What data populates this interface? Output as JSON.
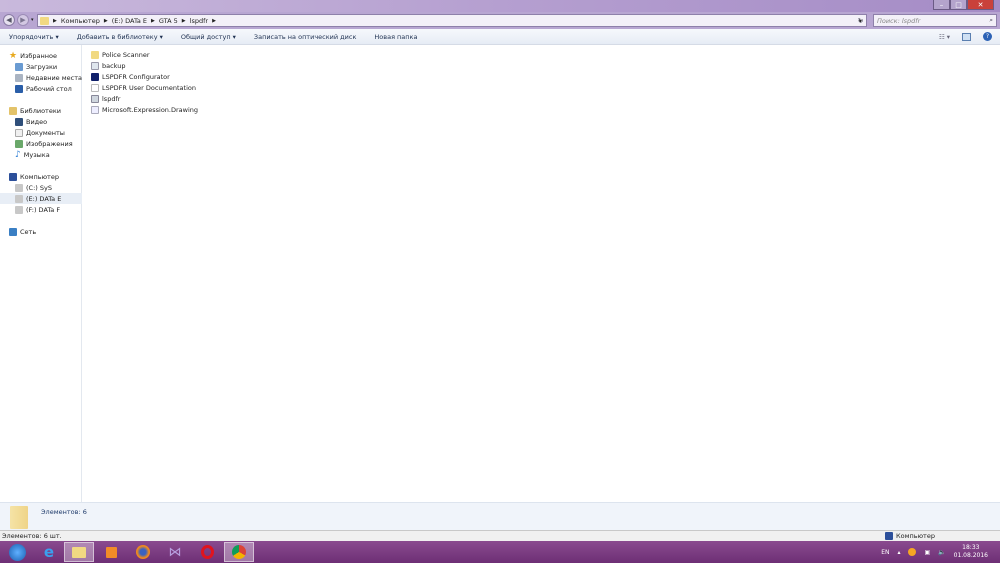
{
  "window": {
    "controls": [
      "minimize",
      "maximize",
      "close"
    ]
  },
  "address": {
    "breadcrumb": [
      "Компьютер",
      "(E:) DATa E",
      "GTA 5",
      "lspdfr"
    ],
    "search_placeholder": "Поиск: lspdfr"
  },
  "toolbar": {
    "items": [
      "Упорядочить ▾",
      "Добавить в библиотеку ▾",
      "Общий доступ ▾",
      "Записать на оптический диск",
      "Новая папка"
    ]
  },
  "sidebar": {
    "favorites": {
      "label": "Избранное",
      "items": [
        "Загрузки",
        "Недавние места",
        "Рабочий стол"
      ]
    },
    "libraries": {
      "label": "Библиотеки",
      "items": [
        "Видео",
        "Документы",
        "Изображения",
        "Музыка"
      ]
    },
    "computer": {
      "label": "Компьютер",
      "items": [
        "(C:) SyS",
        "(E:) DATa E",
        "(F:) DATa F"
      ],
      "selected": "(E:) DATa E"
    },
    "network": {
      "label": "Сеть"
    }
  },
  "files": [
    {
      "name": "Police Scanner",
      "icon": "folder-icon"
    },
    {
      "name": "backup",
      "icon": "file-icon"
    },
    {
      "name": "LSPDFR Configurator",
      "icon": "app-icon"
    },
    {
      "name": "LSPDFR User Documentation",
      "icon": "document-icon"
    },
    {
      "name": "lspdfr",
      "icon": "settings-file-icon"
    },
    {
      "name": "Microsoft.Expression.Drawing",
      "icon": "dll-icon"
    }
  ],
  "details": {
    "count": "Элементов: 6"
  },
  "statusbar": {
    "left": "Элементов: 6 шт.",
    "right": "Компьютер"
  },
  "tray": {
    "lang": "EN",
    "time": "18:33",
    "date": "01.08.2016"
  }
}
